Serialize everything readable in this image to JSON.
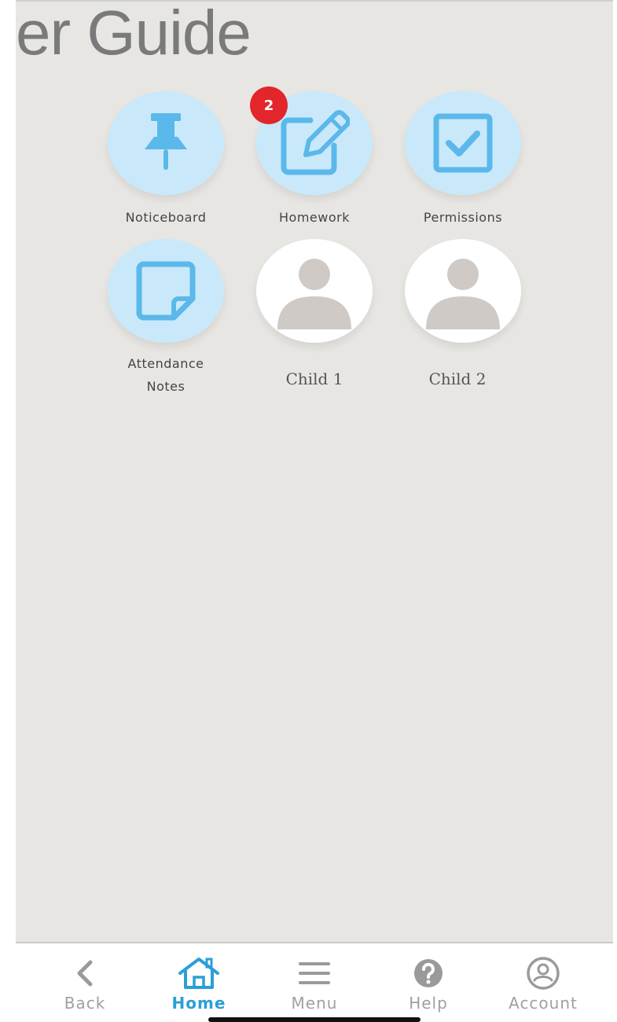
{
  "header": {
    "title": "er Guide"
  },
  "tiles": [
    {
      "label": "Noticeboard",
      "icon": "pushpin-icon"
    },
    {
      "label": "Homework",
      "icon": "edit-note-icon",
      "badge": "2"
    },
    {
      "label": "Permissions",
      "icon": "checkbox-icon"
    },
    {
      "label": "Attendance\nNotes",
      "icon": "sticky-note-icon"
    },
    {
      "label": "Child 1",
      "icon": "person-avatar-icon"
    },
    {
      "label": "Child 2",
      "icon": "person-avatar-icon"
    }
  ],
  "tabbar": {
    "items": [
      {
        "label": "Back",
        "icon": "chevron-left-icon"
      },
      {
        "label": "Home",
        "icon": "home-icon",
        "active": true
      },
      {
        "label": "Menu",
        "icon": "hamburger-menu-icon"
      },
      {
        "label": "Help",
        "icon": "question-circle-icon"
      },
      {
        "label": "Account",
        "icon": "user-circle-icon"
      }
    ]
  },
  "colors": {
    "accent": "#2b9fd6",
    "tile_bg": "#c9e9fa",
    "icon_blue": "#5bb8ea",
    "badge": "#e3262c",
    "screen_bg": "#e8e6e3",
    "avatar_gray": "#cfcac5"
  }
}
